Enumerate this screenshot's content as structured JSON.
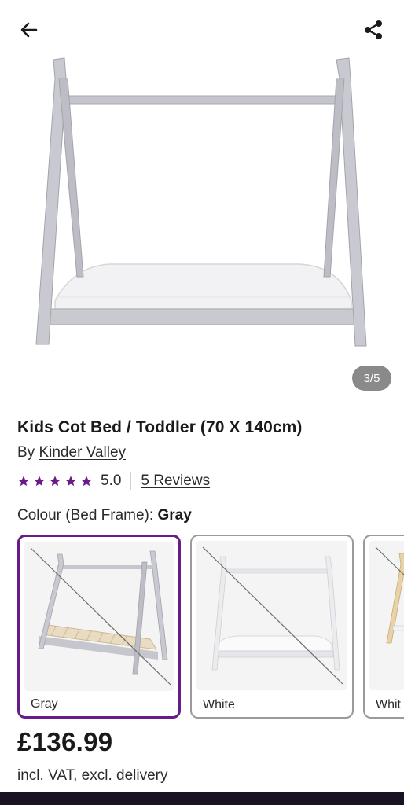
{
  "header": {
    "back_icon": "arrow-left-icon",
    "share_icon": "share-icon"
  },
  "gallery": {
    "counter": "3/5"
  },
  "product": {
    "title": "Kids Cot Bed / Toddler (70 X 140cm)",
    "by_prefix": "By",
    "brand": "Kinder Valley",
    "rating": {
      "stars": 5,
      "score": "5.0",
      "reviews_label": "5 Reviews"
    },
    "colour_label": "Colour (Bed Frame):",
    "colour_value": "Gray",
    "swatches": [
      {
        "label": "Gray",
        "selected": true
      },
      {
        "label": "White",
        "selected": false
      },
      {
        "label": "Whit",
        "selected": false
      }
    ],
    "price": "£136.99",
    "price_note": "incl. VAT, excl. delivery"
  },
  "colors": {
    "accent": "#6a1b8a",
    "star": "#6a1b8a",
    "counter_bg": "#8a8a8a"
  }
}
